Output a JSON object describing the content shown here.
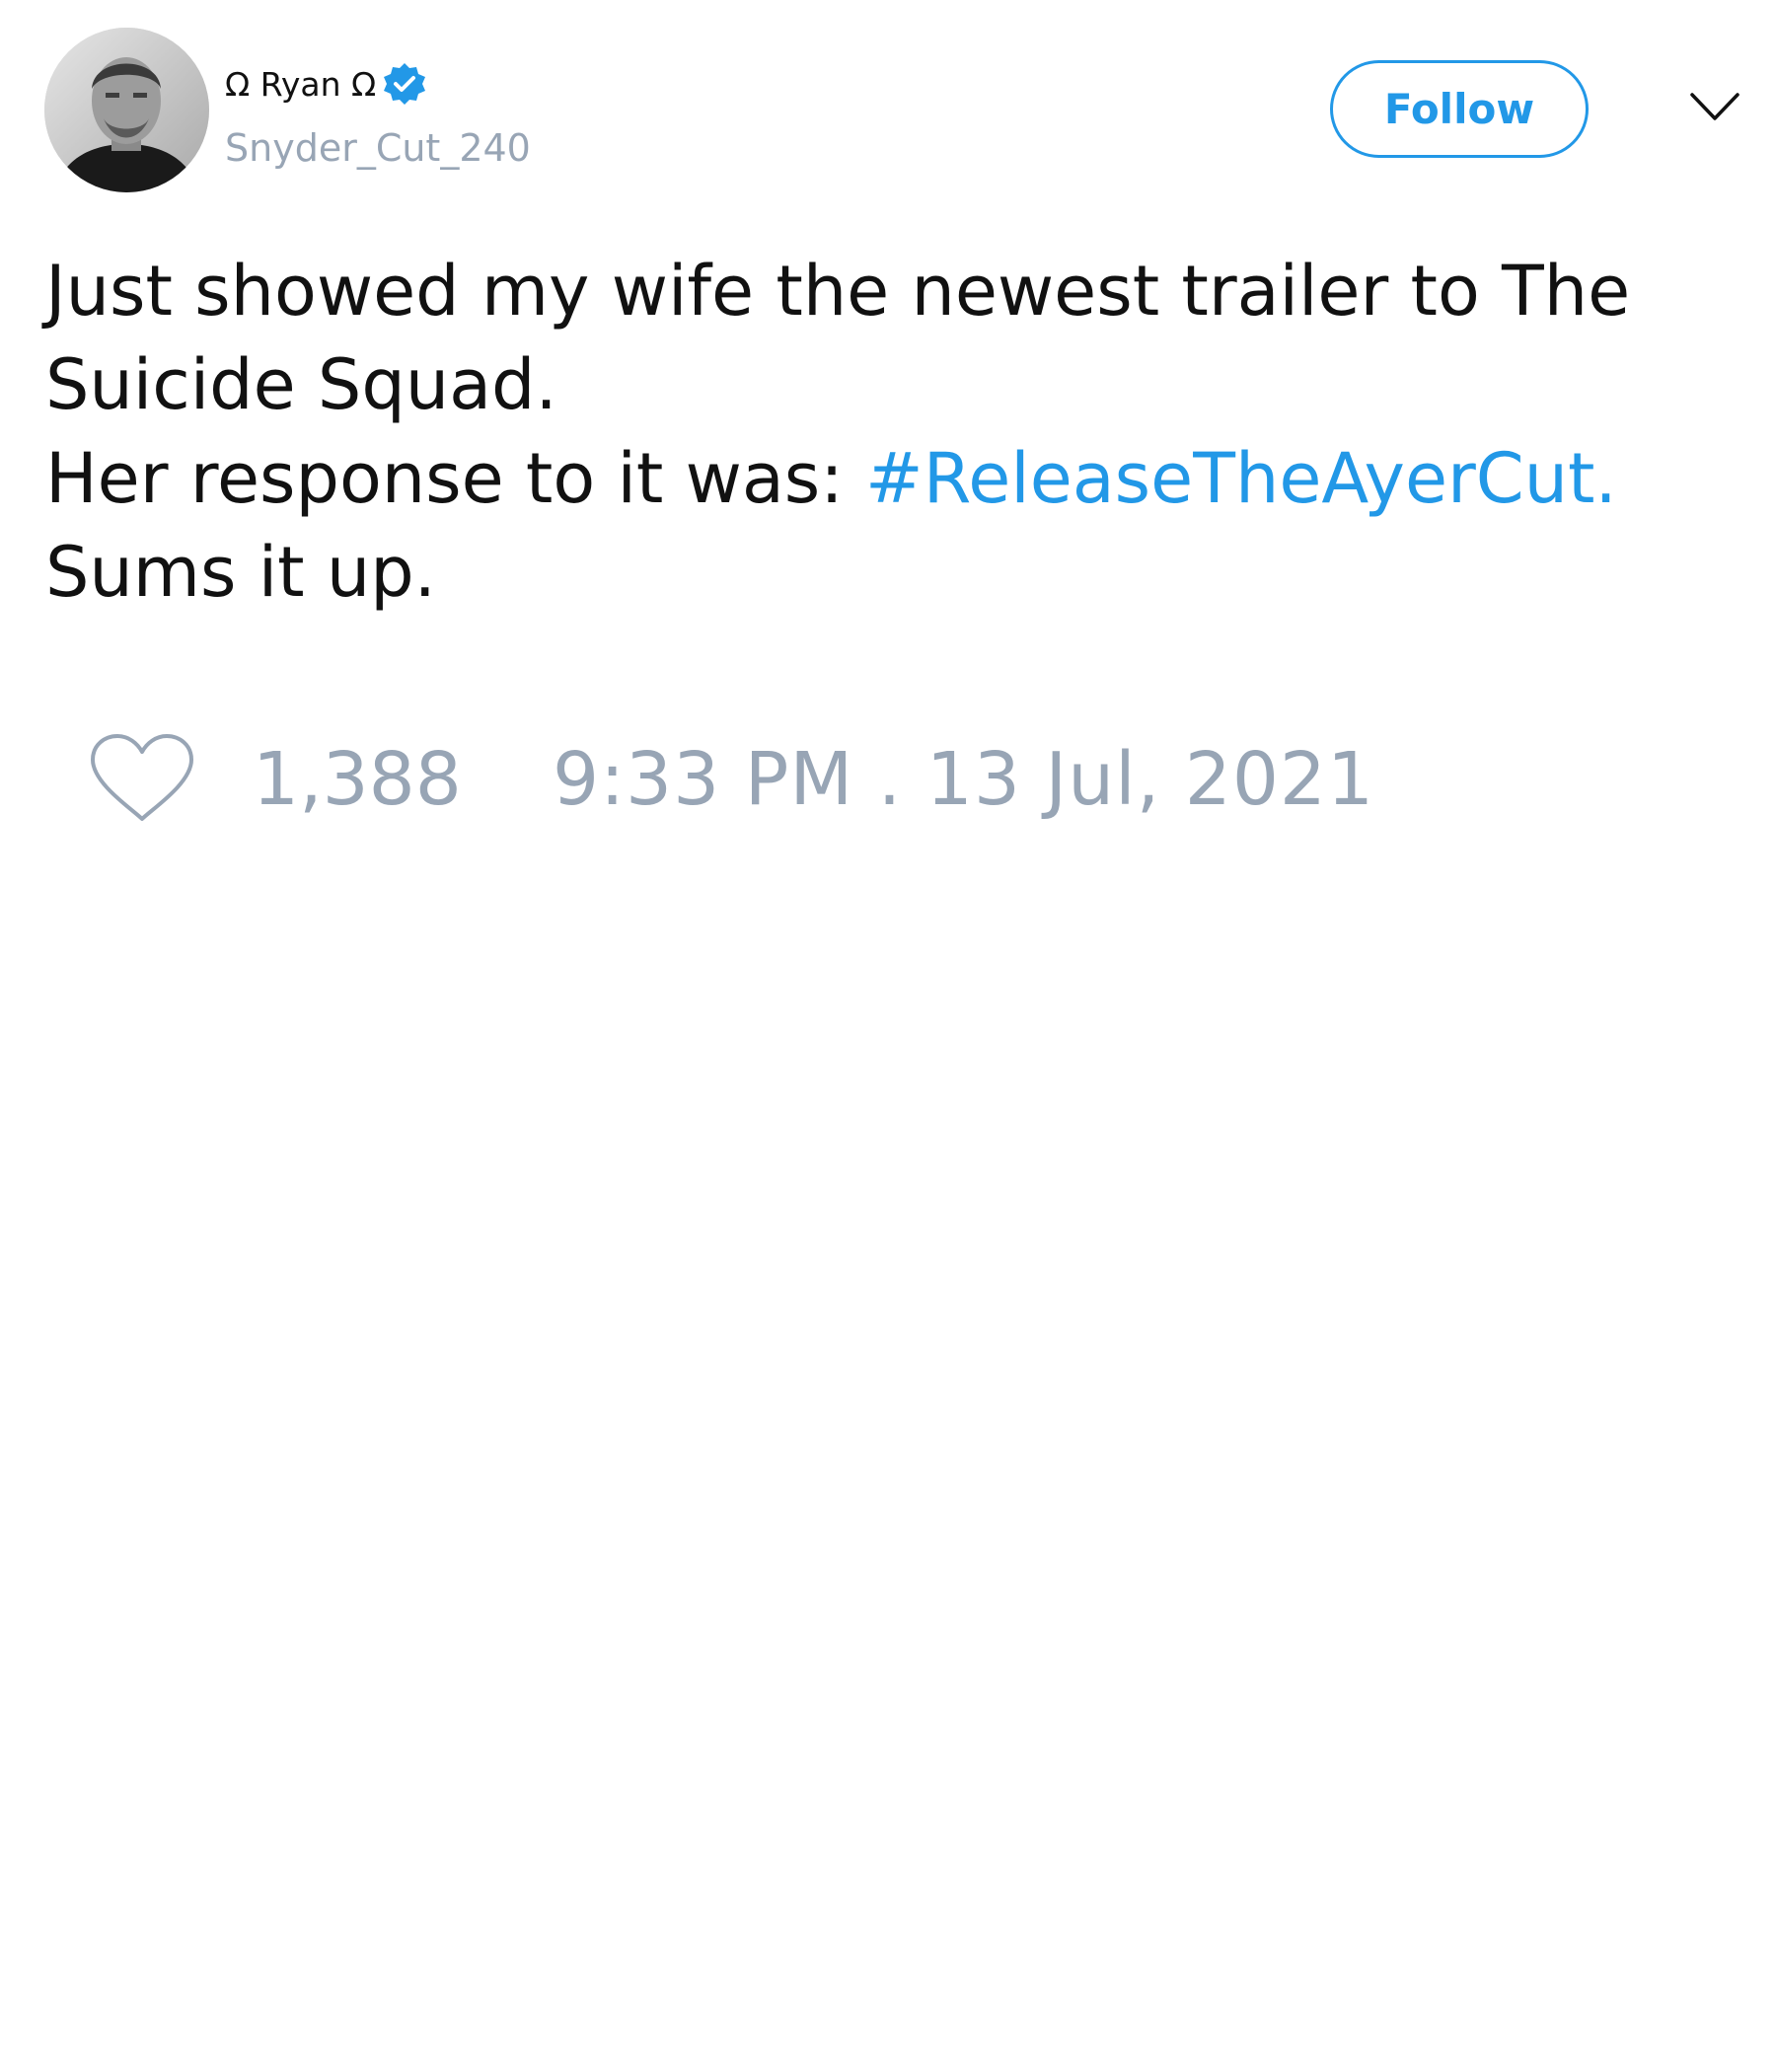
{
  "author": {
    "display_name": "Ω Ryan Ω",
    "handle": "Snyder_Cut_240",
    "verified": true,
    "avatar_icon": "person-portrait-grayscale"
  },
  "header": {
    "follow_label": "Follow",
    "menu_icon": "chevron-down-icon"
  },
  "tweet": {
    "line1": "Just showed my wife the newest trailer to The",
    "line2": "Suicide Squad.",
    "line3_prefix": "Her response to it was: ",
    "hashtag": "#ReleaseTheAyerCut.",
    "line4": "Sums it up."
  },
  "footer": {
    "like_icon": "heart-icon",
    "like_count": "1,388",
    "timestamp": "9:33 PM . 13 Jul, 2021"
  },
  "colors": {
    "accent": "#2298e7",
    "muted": "#98a5b5",
    "text": "#111111",
    "background": "#ffffff"
  }
}
